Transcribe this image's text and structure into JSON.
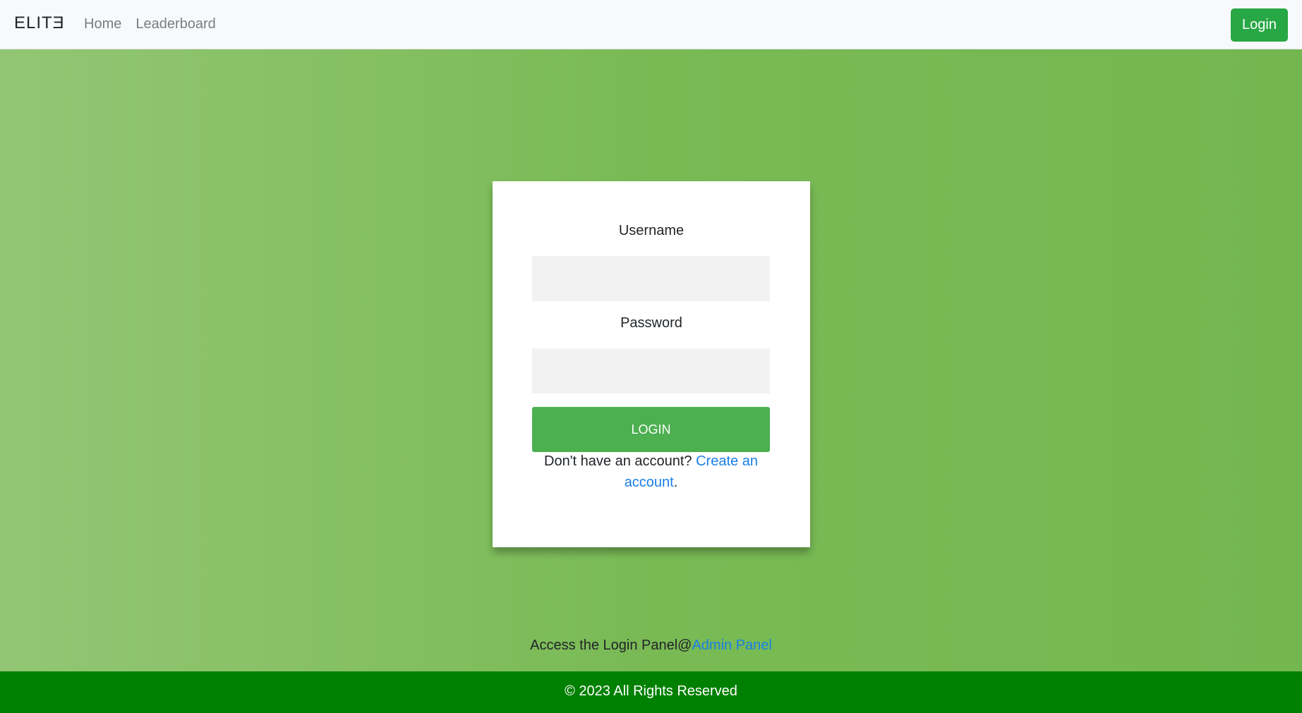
{
  "navbar": {
    "brand": "ELITƎ",
    "links": [
      {
        "label": "Home"
      },
      {
        "label": "Leaderboard"
      }
    ],
    "login_label": "Login"
  },
  "login_form": {
    "username_label": "Username",
    "username_value": "",
    "password_label": "Password",
    "password_value": "",
    "submit_label": "LOGIN",
    "signup_prefix": "Don't have an account? ",
    "signup_link": "Create an account",
    "signup_suffix": "."
  },
  "admin": {
    "prefix": "Access the Login Panel@",
    "link": "Admin Panel"
  },
  "footer": {
    "text": "© 2023 All Rights Reserved"
  },
  "colors": {
    "accent_green": "#28a745",
    "button_green": "#4caf50",
    "footer_green": "#008000",
    "link_blue": "#1a7fe6"
  }
}
